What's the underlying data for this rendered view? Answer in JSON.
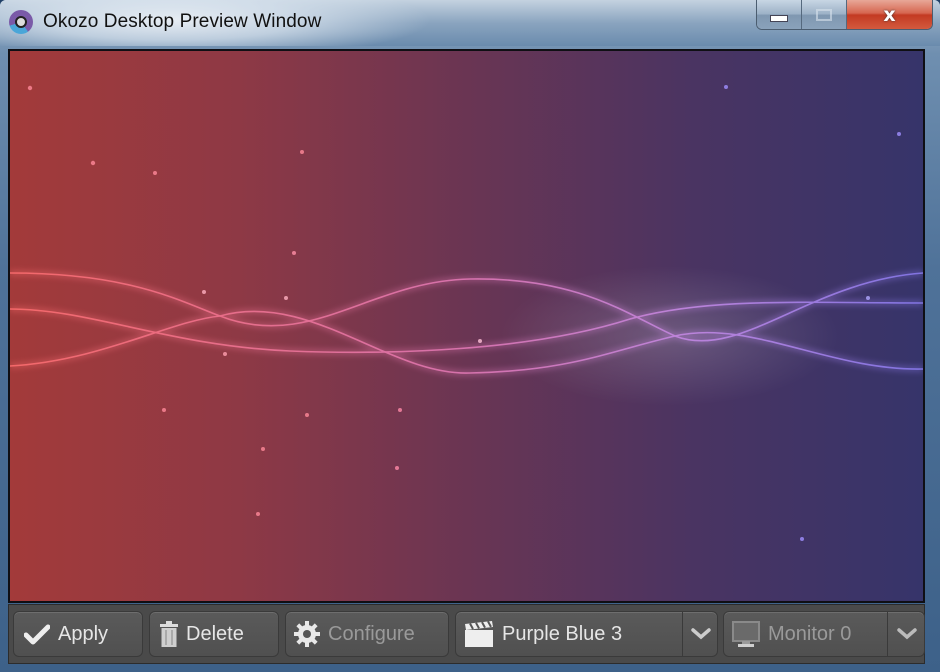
{
  "window": {
    "title": "Okozo Desktop Preview Window",
    "icon": "okozo-app-icon",
    "caption_buttons": {
      "minimize": "minimize-icon",
      "maximize": "maximize-icon",
      "close_label": "x"
    }
  },
  "preview": {
    "description": "Animated wallpaper preview: red-to-purple-blue gradient with wavy glowing light ribbons and sparkles",
    "colors": {
      "left": "#a33a3a",
      "middle": "#6a3553",
      "right": "#36346a"
    }
  },
  "toolbar": {
    "apply_label": "Apply",
    "delete_label": "Delete",
    "configure_label": "Configure",
    "theme_selected": "Purple Blue 3",
    "monitor_selected": "Monitor 0",
    "icons": {
      "apply": "check-icon",
      "delete": "trash-icon",
      "configure": "gear-icon",
      "theme": "clapperboard-icon",
      "monitor": "monitor-icon",
      "dropdown": "chevron-down-icon"
    }
  }
}
